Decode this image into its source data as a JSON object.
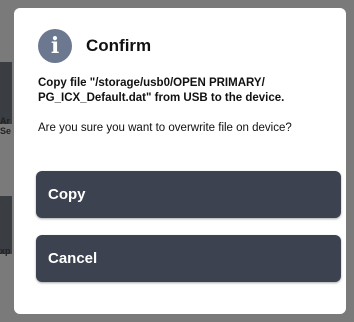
{
  "dialog": {
    "icon": "info-icon",
    "title": "Confirm",
    "message": "Copy file \"/storage/usb0/OPEN PRIMARY/\nPG_ICX_Default.dat\" from USB to the device.",
    "question": "Are you sure you want to overwrite file on device?",
    "buttons": {
      "copy": "Copy",
      "cancel": "Cancel"
    }
  },
  "background": {
    "fragment_1": "Ar\nSe",
    "fragment_2": "xp"
  },
  "colors": {
    "button": "#3c4250",
    "icon": "#6b7890",
    "overlay": "#7a7a7a"
  }
}
